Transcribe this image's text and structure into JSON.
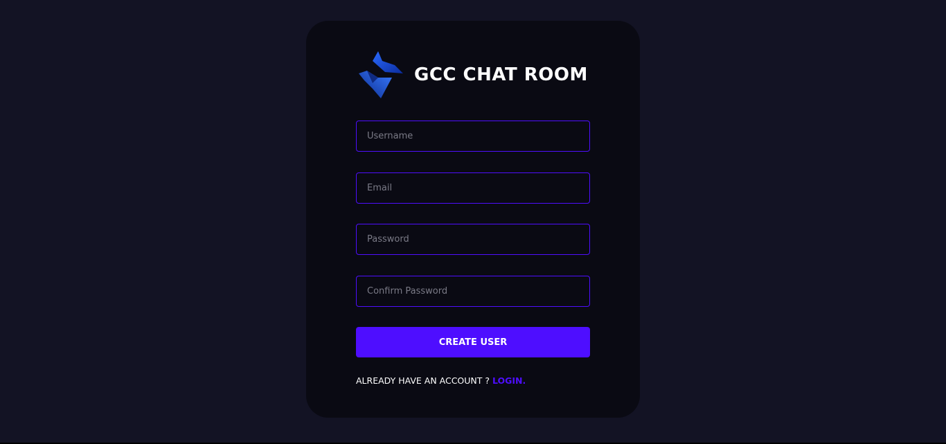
{
  "brand": {
    "title": "GCC CHAT ROOM",
    "logo_icon": "blue-ribbon-logo-icon"
  },
  "form": {
    "username": {
      "placeholder": "Username",
      "value": ""
    },
    "email": {
      "placeholder": "Email",
      "value": ""
    },
    "password": {
      "placeholder": "Password",
      "value": ""
    },
    "confirm_password": {
      "placeholder": "Confirm Password",
      "value": ""
    },
    "submit_label": "CREATE USER"
  },
  "footer": {
    "prompt": "ALREADY HAVE AN ACCOUNT ? ",
    "link_label": "LOGIN."
  },
  "colors": {
    "page_background": "#131324",
    "card_background": "#0a0a13",
    "accent": "#4e0eff",
    "text": "#ffffff",
    "placeholder": "#7a7a86"
  }
}
